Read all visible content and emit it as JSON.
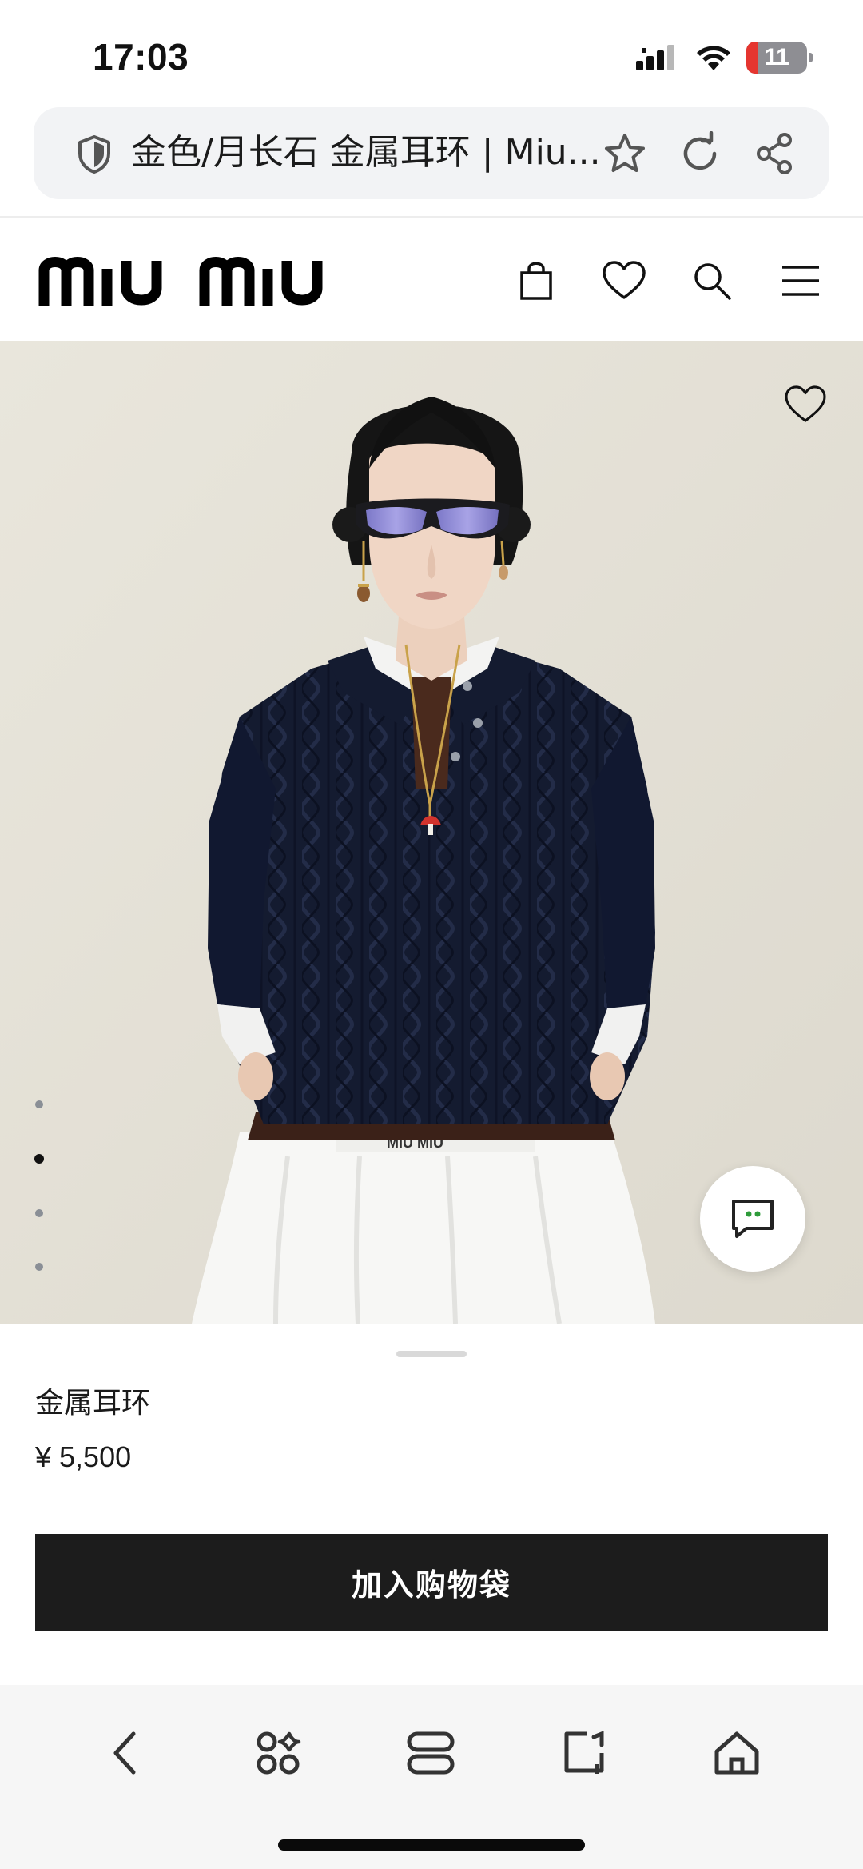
{
  "status_bar": {
    "time": "17:03",
    "battery_level": "11",
    "icons": [
      "signal-icon",
      "wifi-icon",
      "battery-icon"
    ]
  },
  "browser": {
    "url_title": "金色/月长石 金属耳环 | Miu...",
    "icons": [
      "shield-icon",
      "star-icon",
      "reload-icon",
      "share-icon"
    ]
  },
  "site": {
    "brand": "miu miu",
    "icons": [
      "shopping-bag-icon",
      "heart-icon",
      "search-icon",
      "menu-icon"
    ]
  },
  "gallery": {
    "total_images": 4,
    "active_index": 1
  },
  "product": {
    "name": "金属耳环",
    "price": "¥ 5,500",
    "add_to_bag_label": "加入购物袋"
  },
  "toolbar": {
    "icons": [
      "back-icon",
      "apps-icon",
      "tabs-icon",
      "new-tab-icon",
      "home-icon"
    ]
  },
  "colors": {
    "button_bg": "#1c1c1c",
    "sweater": "#141b30",
    "battery_low": "#e5352f"
  }
}
